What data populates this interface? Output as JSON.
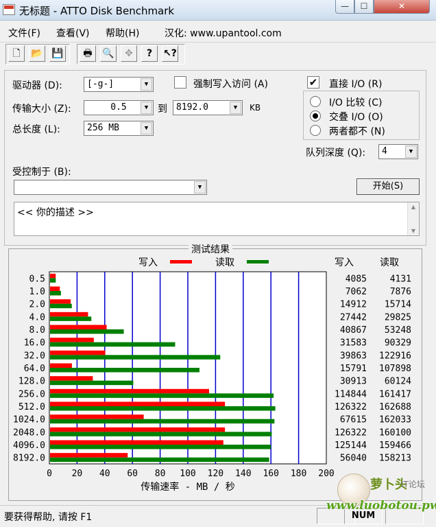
{
  "window": {
    "title": "无标题 - ATTO Disk Benchmark",
    "min": "—",
    "max": "☐",
    "close": "✕"
  },
  "menu": {
    "file": "文件(F)",
    "view": "查看(V)",
    "help": "帮助(H)",
    "hanhua": "汉化: www.upantool.com"
  },
  "toolbar": {
    "icons": [
      "new-icon",
      "open-icon",
      "save-icon",
      "print-icon",
      "print-preview-icon",
      "move-icon",
      "help-icon",
      "context-help-icon"
    ]
  },
  "form": {
    "drive_label": "驱动器 (D):",
    "drive_value": "[-g-]",
    "force_write_label": "强制写入访问 (A)",
    "direct_io_label": "直接 I/O (R)",
    "direct_io_checked": true,
    "transfer_label": "传输大小 (Z):",
    "transfer_from": "0.5",
    "transfer_to_label": "到",
    "transfer_to": "8192.0",
    "transfer_unit": "KB",
    "total_label": "总长度 (L):",
    "total_value": "256 MB",
    "io_compare_label": "I/O 比较 (C)",
    "overlap_label": "交叠 I/O (O)",
    "neither_label": "两者都不 (N)",
    "queue_label": "队列深度 (Q):",
    "queue_value": "4",
    "controlled_label": "受控制于 (B):",
    "controlled_value": "",
    "start_button": "开始(S)",
    "description": "<<   你的描述    >>"
  },
  "results": {
    "group_title": "测试结果",
    "legend_write": "写入",
    "legend_read": "读取",
    "col_write": "写入",
    "col_read": "读取",
    "write_color": "#ff0000",
    "read_color": "#008000"
  },
  "chart_data": {
    "type": "bar",
    "orientation": "horizontal",
    "categories": [
      "0.5",
      "1.0",
      "2.0",
      "4.0",
      "8.0",
      "16.0",
      "32.0",
      "64.0",
      "128.0",
      "256.0",
      "512.0",
      "1024.0",
      "2048.0",
      "4096.0",
      "8192.0"
    ],
    "series": [
      {
        "name": "写入",
        "values": [
          4085,
          7062,
          14912,
          27442,
          40867,
          31583,
          39863,
          15791,
          30913,
          114844,
          126322,
          67615,
          126322,
          125144,
          56040
        ]
      },
      {
        "name": "读取",
        "values": [
          4131,
          7876,
          15714,
          29825,
          53248,
          90329,
          122916,
          107898,
          60124,
          161417,
          162688,
          162033,
          160100,
          159466,
          158213
        ]
      }
    ],
    "xlabel": "传输速率 - MB / 秒",
    "xlim": [
      0,
      200
    ],
    "xticks": [
      "0",
      "20",
      "40",
      "60",
      "80",
      "100",
      "120",
      "140",
      "160",
      "180",
      "200"
    ],
    "grid": true
  },
  "status": {
    "help_text": "要获得帮助, 请按 F1",
    "num": "NUM"
  },
  "watermark": {
    "name": "萝卜头",
    "tag": "IT论坛",
    "url": "www.luobotou.pw"
  }
}
